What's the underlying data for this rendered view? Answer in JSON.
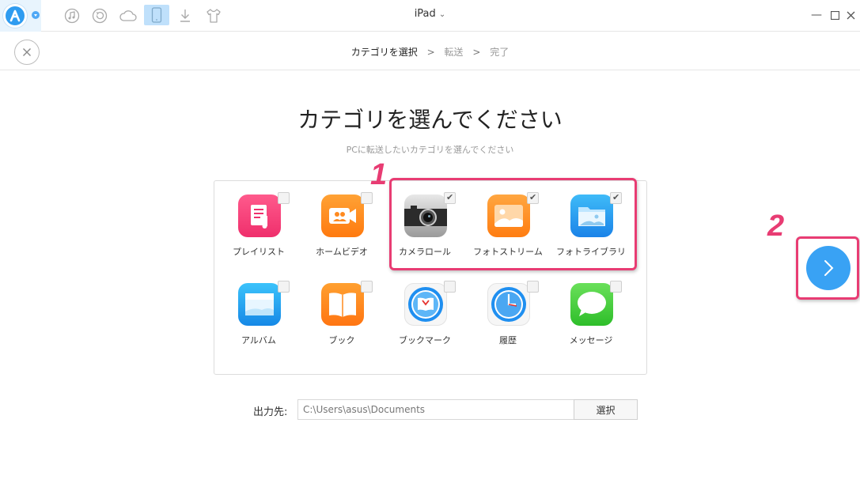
{
  "titlebar": {
    "device_name": "iPad",
    "toolbar_icons": [
      "music-icon",
      "restore-icon",
      "cloud-icon",
      "device-icon",
      "download-icon",
      "tshirt-icon"
    ]
  },
  "steps": {
    "current": "カテゴリを選択",
    "transfer": "転送",
    "done": "完了",
    "separator": ">"
  },
  "main": {
    "heading": "カテゴリを選んでください",
    "subheading": "PCに転送したいカテゴリを選んでください"
  },
  "categories": [
    {
      "label": "プレイリスト",
      "icon": "playlist-icon",
      "checked": false
    },
    {
      "label": "ホームビデオ",
      "icon": "home-video-icon",
      "checked": false
    },
    {
      "label": "カメラロール",
      "icon": "camera-icon",
      "checked": true
    },
    {
      "label": "フォトストリーム",
      "icon": "photo-stream-icon",
      "checked": true
    },
    {
      "label": "フォトライブラリ",
      "icon": "photo-library-icon",
      "checked": true
    },
    {
      "label": "アルバム",
      "icon": "album-icon",
      "checked": false
    },
    {
      "label": "ブック",
      "icon": "book-icon",
      "checked": false
    },
    {
      "label": "ブックマーク",
      "icon": "bookmark-icon",
      "checked": false
    },
    {
      "label": "履歴",
      "icon": "history-icon",
      "checked": false
    },
    {
      "label": "メッセージ",
      "icon": "messages-icon",
      "checked": false
    }
  ],
  "annotations": {
    "one": "1",
    "two": "2"
  },
  "output": {
    "label": "出力先:",
    "path": "C:\\Users\\asus\\Documents",
    "select_button": "選択"
  },
  "colors": {
    "accent": "#39a2f4",
    "annotation": "#e83c73"
  }
}
